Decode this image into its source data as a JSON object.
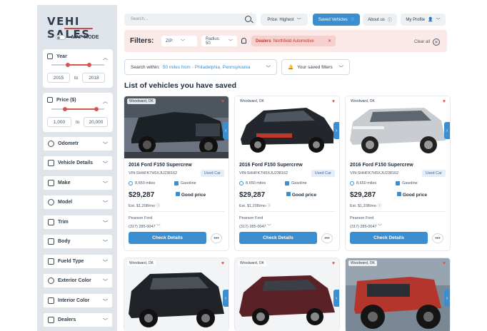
{
  "brand": {
    "logo": "VEHI SALES",
    "map_mode": "MAP MODE"
  },
  "sidebar": {
    "year": {
      "label": "Year",
      "min": "2015",
      "to": "to",
      "max": "2018"
    },
    "price": {
      "label": "Price ($)",
      "min": "1,000",
      "to": "to",
      "max": "20,000"
    },
    "collapsed": [
      {
        "label": "Odometr"
      },
      {
        "label": "Vehicle Details"
      },
      {
        "label": "Make"
      },
      {
        "label": "Model"
      },
      {
        "label": "Trim"
      },
      {
        "label": "Body"
      },
      {
        "label": "Fueld Type"
      },
      {
        "label": "Exterior Color"
      },
      {
        "label": "Interior Color"
      },
      {
        "label": "Dealers"
      }
    ]
  },
  "topbar": {
    "search_placeholder": "Search...",
    "sort": "Price: Highest",
    "saved_vehicles": "Saved Vehicles",
    "about": "About us",
    "profile": "My Profile"
  },
  "filters": {
    "title": "Filters:",
    "zip": "ZIP:",
    "radius": "Radius: 50",
    "dealers_label": "Dealers",
    "dealers_value": "Northfield Automotive",
    "clear_all": "Clear all"
  },
  "search_within": {
    "label": "Search within:",
    "value": "50 miles from - Philadelphia, Pennsylvania"
  },
  "saved_filters": "Your saved filters",
  "list_title": "List of vehicles you have saved",
  "cards": [
    {
      "location": "Woodward, OK",
      "title": "2016 Ford F150 Supercrew",
      "vin": "VIN:SHHFK7H5XJU238162",
      "badge": "Used Car",
      "mileage": "8,650 miles",
      "fuel": "Gasoline",
      "price": "$29,287",
      "deal": "Good price",
      "est": "Est. $1,208/mo",
      "dealer": "Pearson Ford",
      "phone": "(317) 285-0047",
      "cta": "Check Details",
      "body_color": "#1c2126"
    },
    {
      "location": "Woodward, OK",
      "title": "2016 Ford F150 Supercrew",
      "vin": "VIN:SHHFK7H5XJU238162",
      "badge": "Used Car",
      "mileage": "8,650 miles",
      "fuel": "Gasoline",
      "price": "$29,287",
      "deal": "Good price",
      "est": "Est. $1,208/mo",
      "dealer": "Pearson Ford",
      "phone": "(317) 285-0047",
      "cta": "Check Details",
      "body_color": "#23272d"
    },
    {
      "location": "Woodward, OK",
      "title": "2016 Ford F150 Supercrew",
      "vin": "VIN:SHHFK7H5XJU238162",
      "badge": "Used Car",
      "mileage": "8,650 miles",
      "fuel": "Gasoline",
      "price": "$29,287",
      "deal": "Good price",
      "est": "Est. $1,208/mo",
      "dealer": "Pearson Ford",
      "phone": "(317) 285-0047",
      "cta": "Check Details",
      "body_color": "#c9ccd0"
    },
    {
      "location": "Woodward, OK",
      "body_color": "#202428"
    },
    {
      "location": "Woodward, OK",
      "body_color": "#5a2226"
    },
    {
      "location": "Woodward, OK",
      "body_color": "#b3352c"
    }
  ]
}
